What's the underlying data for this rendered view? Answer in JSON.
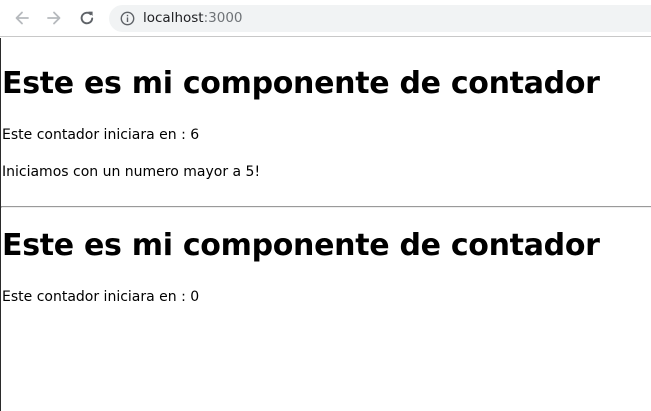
{
  "browser": {
    "url_host": "localhost",
    "url_port": ":3000"
  },
  "counters": [
    {
      "title": "Este es mi componente de contador",
      "start_text": "Este contador iniciara en : 6",
      "message": "Iniciamos con un numero mayor a 5!"
    },
    {
      "title": "Este es mi componente de contador",
      "start_text": "Este contador iniciara en : 0"
    }
  ]
}
